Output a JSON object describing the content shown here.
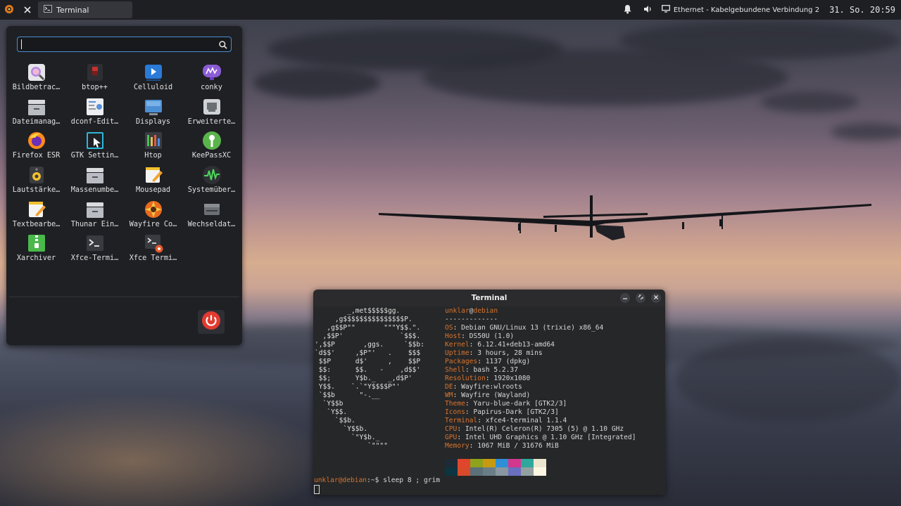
{
  "panel": {
    "taskbar_item_label": "Terminal",
    "network_label": "Ethernet - Kabelgebundene Verbindung 2",
    "clock": "31. So. 20:59"
  },
  "menu": {
    "search": {
      "value": "",
      "placeholder": ""
    },
    "apps": [
      {
        "label": "Bildbetrac…",
        "icon": "image-viewer-icon"
      },
      {
        "label": "btop++",
        "icon": "btop-icon"
      },
      {
        "label": "Celluloid",
        "icon": "video-player-icon"
      },
      {
        "label": "conky",
        "icon": "conky-icon"
      },
      {
        "label": "Dateimanag…",
        "icon": "file-manager-icon"
      },
      {
        "label": "dconf-Edit…",
        "icon": "dconf-editor-icon"
      },
      {
        "label": "Displays",
        "icon": "displays-icon"
      },
      {
        "label": "Erweiterte…",
        "icon": "network-settings-icon"
      },
      {
        "label": "Firefox ESR",
        "icon": "firefox-icon"
      },
      {
        "label": "GTK Settin…",
        "icon": "gtk-settings-icon"
      },
      {
        "label": "Htop",
        "icon": "htop-icon"
      },
      {
        "label": "KeePassXC",
        "icon": "keepassxc-icon"
      },
      {
        "label": "Lautstärke…",
        "icon": "volume-control-icon"
      },
      {
        "label": "Massenumbe…",
        "icon": "bulk-rename-icon"
      },
      {
        "label": "Mousepad",
        "icon": "text-editor-icon"
      },
      {
        "label": "Systemüber…",
        "icon": "system-monitor-icon"
      },
      {
        "label": "Textbearbe…",
        "icon": "text-editor-icon"
      },
      {
        "label": "Thunar Ein…",
        "icon": "thunar-settings-icon"
      },
      {
        "label": "Wayfire Co…",
        "icon": "wayfire-config-icon"
      },
      {
        "label": "Wechseldat…",
        "icon": "removable-drives-icon"
      },
      {
        "label": "Xarchiver",
        "icon": "archive-manager-icon"
      },
      {
        "label": "Xfce-Termi…",
        "icon": "terminal-icon"
      },
      {
        "label": "Xfce Termi…",
        "icon": "terminal-settings-icon"
      }
    ]
  },
  "terminal": {
    "title": "Terminal",
    "ascii_art": "        _,met$$$$$gg.\n     ,g$$$$$$$$$$$$$$$P.\n   ,g$$P\"\"       \"\"\"Y$$.\".\n  ,$$P'              `$$$.\n',$$P       ,ggs.     `$$b:\n`d$$'     ,$P\"'   .    $$$\n $$P      d$'     ,    $$P\n $$:      $$.   -    ,d$$'\n $$;      Y$b._   _,d$P'\n Y$$.    `.`\"Y$$$$P\"'\n `$$b      \"-.__\n  `Y$$b\n   `Y$$.\n     `$$b.\n       `Y$$b.\n         `\"Y$b._\n             `\"\"\"\"",
    "user": "unklar",
    "host": "debian",
    "separator": "-------------",
    "info": [
      {
        "key": "OS",
        "value": "Debian GNU/Linux 13 (trixie) x86_64"
      },
      {
        "key": "Host",
        "value": "DS50U (1.0)"
      },
      {
        "key": "Kernel",
        "value": "6.12.41+deb13-amd64"
      },
      {
        "key": "Uptime",
        "value": "3 hours, 28 mins"
      },
      {
        "key": "Packages",
        "value": "1137 (dpkg)"
      },
      {
        "key": "Shell",
        "value": "bash 5.2.37"
      },
      {
        "key": "Resolution",
        "value": "1920x1080"
      },
      {
        "key": "DE",
        "value": "Wayfire:wlroots"
      },
      {
        "key": "WM",
        "value": "Wayfire (Wayland)"
      },
      {
        "key": "Theme",
        "value": "Yaru-blue-dark [GTK2/3]"
      },
      {
        "key": "Icons",
        "value": "Papirus-Dark [GTK2/3]"
      },
      {
        "key": "Terminal",
        "value": "xfce4-terminal 1.1.4"
      },
      {
        "key": "CPU",
        "value": "Intel(R) Celeron(R) 7305 (5) @ 1.10 GHz"
      },
      {
        "key": "GPU",
        "value": "Intel UHD Graphics @ 1.10 GHz [Integrated]"
      },
      {
        "key": "Memory",
        "value": "1067 MiB / 31676 MiB"
      }
    ],
    "palette_top": [
      "#1d2b36",
      "#e0462e",
      "#8fa21c",
      "#c89a12",
      "#2e8fd6",
      "#d4378e",
      "#2ea89d",
      "#ece5d0"
    ],
    "palette_bottom": [
      "#0b3541",
      "#d84a2a",
      "#5b7078",
      "#6a7e88",
      "#8897a0",
      "#6a6fc0",
      "#93a1a1",
      "#fdf6e3"
    ],
    "prompt": {
      "user_host": "unklar@debian",
      "path_and_symbol": ":~$ ",
      "command": "sleep 8 ; grim"
    }
  }
}
